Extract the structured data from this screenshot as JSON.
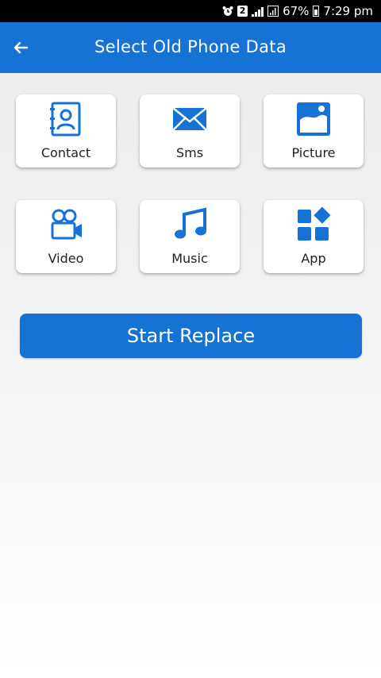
{
  "status_bar": {
    "battery": "67%",
    "time": "7:29 pm",
    "sim_label": "2"
  },
  "app_bar": {
    "title": "Select Old Phone Data",
    "back_icon": "arrow-left-icon"
  },
  "data_types": [
    {
      "label": "Contact",
      "icon": "contact-book-icon"
    },
    {
      "label": "Sms",
      "icon": "envelope-icon"
    },
    {
      "label": "Picture",
      "icon": "picture-icon"
    },
    {
      "label": "Video",
      "icon": "video-camera-icon"
    },
    {
      "label": "Music",
      "icon": "music-note-icon"
    },
    {
      "label": "App",
      "icon": "apps-grid-icon"
    }
  ],
  "start_button": {
    "label": "Start Replace"
  },
  "colors": {
    "primary": "#1672d4",
    "status_bar": "#000000",
    "card_bg": "#ffffff",
    "icon": "#1672d4"
  }
}
